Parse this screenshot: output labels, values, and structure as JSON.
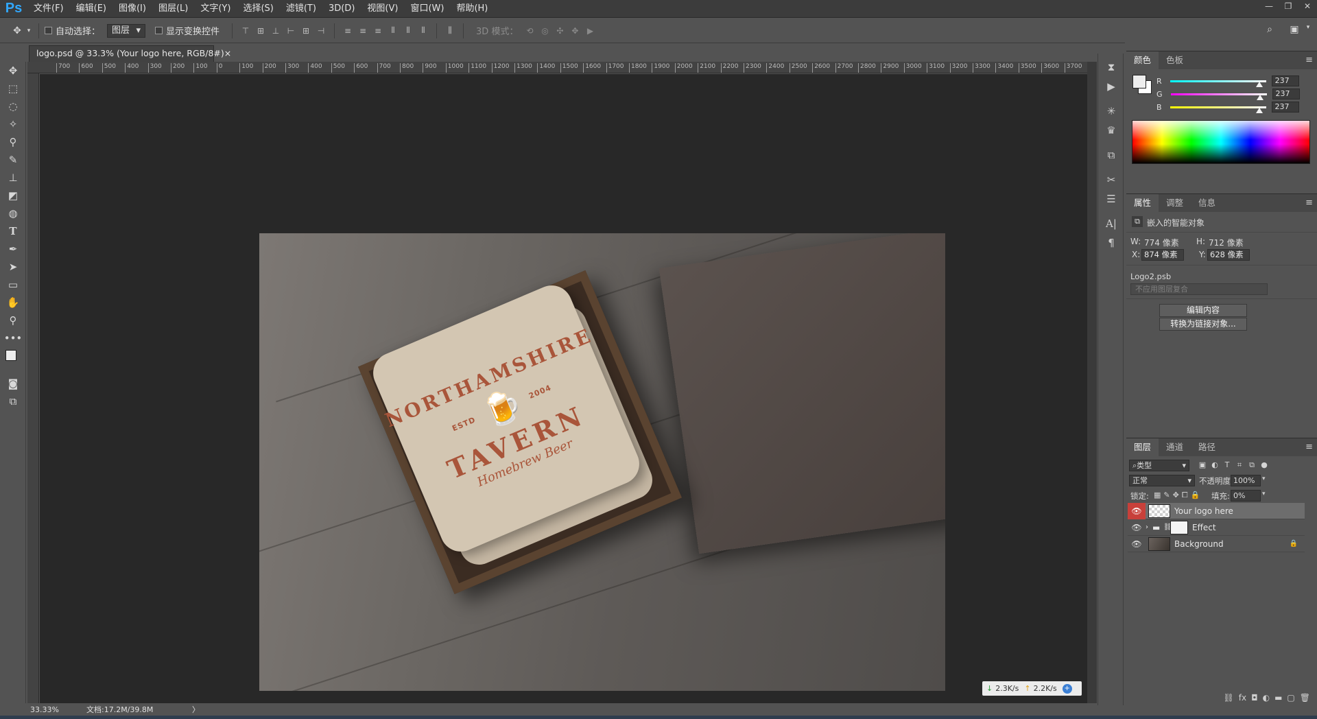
{
  "app": {
    "logo": "Ps"
  },
  "menu": [
    "文件(F)",
    "编辑(E)",
    "图像(I)",
    "图层(L)",
    "文字(Y)",
    "选择(S)",
    "滤镜(T)",
    "3D(D)",
    "视图(V)",
    "窗口(W)",
    "帮助(H)"
  ],
  "options_bar": {
    "auto_select_label": "自动选择：",
    "auto_select_value": "图层",
    "show_transform_label": "显示变换控件",
    "mode_3d_label": "3D 模式："
  },
  "document": {
    "tab_title": "logo.psd @ 33.3% (Your logo here, RGB/8#)",
    "tab_close": "×",
    "ruler_ticks": [
      "700",
      "600",
      "500",
      "400",
      "300",
      "200",
      "100",
      "0",
      "100",
      "200",
      "300",
      "400",
      "500",
      "600",
      "700",
      "800",
      "900",
      "1000",
      "1100",
      "1200",
      "1300",
      "1400",
      "1500",
      "1600",
      "1700",
      "1800",
      "1900",
      "2000",
      "2100",
      "2200",
      "2300",
      "2400",
      "2500",
      "2600",
      "2700",
      "2800",
      "2900",
      "3000",
      "3100",
      "3200",
      "3300",
      "3400",
      "3500",
      "3600",
      "3700"
    ]
  },
  "artwork": {
    "line1": "NORTHAMSHIRE",
    "line2": "TAVERN",
    "line3": "Homebrew Beer",
    "est": "ESTD",
    "year": "2004"
  },
  "net_speed": {
    "down": "2.3K/s",
    "up": "2.2K/s"
  },
  "status": {
    "zoom": "33.33%",
    "doc_size": "文档:17.2M/39.8M",
    "arrow": "〉"
  },
  "color_panel": {
    "tabs": [
      "颜色",
      "色板"
    ],
    "channels": [
      {
        "label": "R",
        "value": "237",
        "level": 0.93,
        "gradient": "#00ffff"
      },
      {
        "label": "G",
        "value": "237",
        "level": 0.93,
        "gradient": "#ff00ff"
      },
      {
        "label": "B",
        "value": "237",
        "level": 0.93,
        "gradient": "#ffff00"
      }
    ]
  },
  "properties_panel": {
    "tabs": [
      "属性",
      "调整",
      "信息"
    ],
    "type_label": "嵌入的智能对象",
    "w_label": "W:",
    "w_value": "774 像素",
    "h_label": "H:",
    "h_value": "712 像素",
    "x_label": "X:",
    "x_value": "874 像素",
    "y_label": "Y:",
    "y_value": "628 像素",
    "file_name": "Logo2.psb",
    "comp_placeholder": "不应用图层复合",
    "edit_button": "编辑内容",
    "convert_button": "转换为链接对象..."
  },
  "layers_panel": {
    "tabs": [
      "图层",
      "通道",
      "路径"
    ],
    "filter_label": "类型",
    "blend_mode": "正常",
    "opacity_label": "不透明度:",
    "opacity_value": "100%",
    "lock_label": "锁定:",
    "fill_label": "填充:",
    "fill_value": "0%",
    "layers": [
      {
        "name": "Your logo here",
        "selected": true
      },
      {
        "name": "Effect",
        "selected": false
      },
      {
        "name": "Background",
        "selected": false
      }
    ],
    "bottom_tools": [
      "GO",
      "fx",
      "◘",
      "◐",
      "▬",
      "▢",
      "🗑"
    ]
  }
}
